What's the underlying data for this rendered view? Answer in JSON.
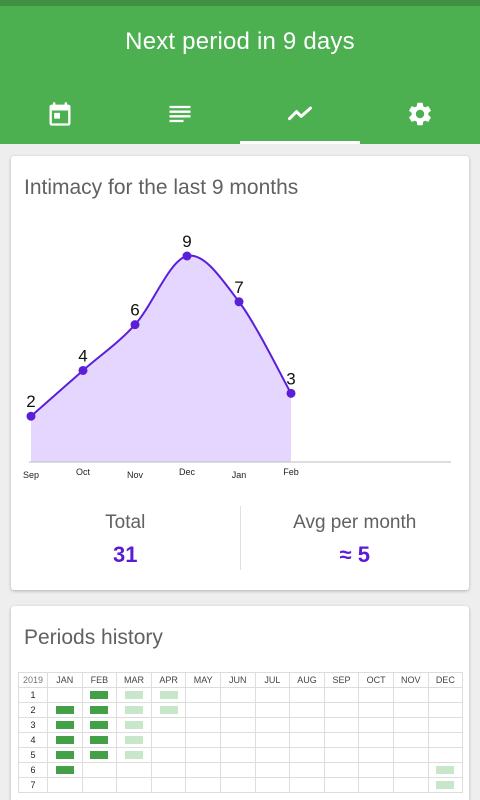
{
  "header": {
    "title": "Next period in 9 days",
    "colors": {
      "appbar": "#4caf50",
      "statusline": "#3d9140"
    },
    "tabs": [
      {
        "name": "calendar",
        "icon": "calendar-icon",
        "active": false
      },
      {
        "name": "notes",
        "icon": "notes-list-icon",
        "active": false
      },
      {
        "name": "stats",
        "icon": "trending-line-icon",
        "active": true
      },
      {
        "name": "settings",
        "icon": "gear-icon",
        "active": false
      }
    ]
  },
  "intimacy": {
    "title": "Intimacy for the last 9 months",
    "total_label": "Total",
    "total_value": "31",
    "avg_label": "Avg per month",
    "avg_value": "≈ 5"
  },
  "chart_data": {
    "type": "area",
    "categories": [
      "Sep",
      "Oct",
      "Nov",
      "Dec",
      "Jan",
      "Feb"
    ],
    "values": [
      2,
      4,
      6,
      9,
      7,
      3
    ],
    "data_labels": true,
    "colors": {
      "line": "#5b1fd8",
      "fill": "#e4d6ff",
      "point": "#5b1fd8"
    },
    "grid": false
  },
  "history": {
    "title": "Periods history",
    "year": "2019",
    "months": [
      "JAN",
      "FEB",
      "MAR",
      "APR",
      "MAY",
      "JUN",
      "JUL",
      "AUG",
      "SEP",
      "OCT",
      "NOV",
      "DEC"
    ],
    "rows": [
      {
        "day": "1",
        "marks": [
          "",
          "dark",
          "light",
          "light",
          "",
          "",
          "",
          "",
          "",
          "",
          "",
          ""
        ]
      },
      {
        "day": "2",
        "marks": [
          "dark",
          "dark",
          "light",
          "light",
          "",
          "",
          "",
          "",
          "",
          "",
          "",
          ""
        ]
      },
      {
        "day": "3",
        "marks": [
          "dark",
          "dark",
          "light",
          "",
          "",
          "",
          "",
          "",
          "",
          "",
          "",
          ""
        ]
      },
      {
        "day": "4",
        "marks": [
          "dark",
          "dark",
          "light",
          "",
          "",
          "",
          "",
          "",
          "",
          "",
          "",
          ""
        ]
      },
      {
        "day": "5",
        "marks": [
          "dark",
          "dark",
          "light",
          "",
          "",
          "",
          "",
          "",
          "",
          "",
          "",
          ""
        ]
      },
      {
        "day": "6",
        "marks": [
          "dark",
          "",
          "",
          "",
          "",
          "",
          "",
          "",
          "",
          "",
          "",
          "light"
        ]
      },
      {
        "day": "7",
        "marks": [
          "",
          "",
          "",
          "",
          "",
          "",
          "",
          "",
          "",
          "",
          "",
          "light"
        ]
      }
    ]
  }
}
